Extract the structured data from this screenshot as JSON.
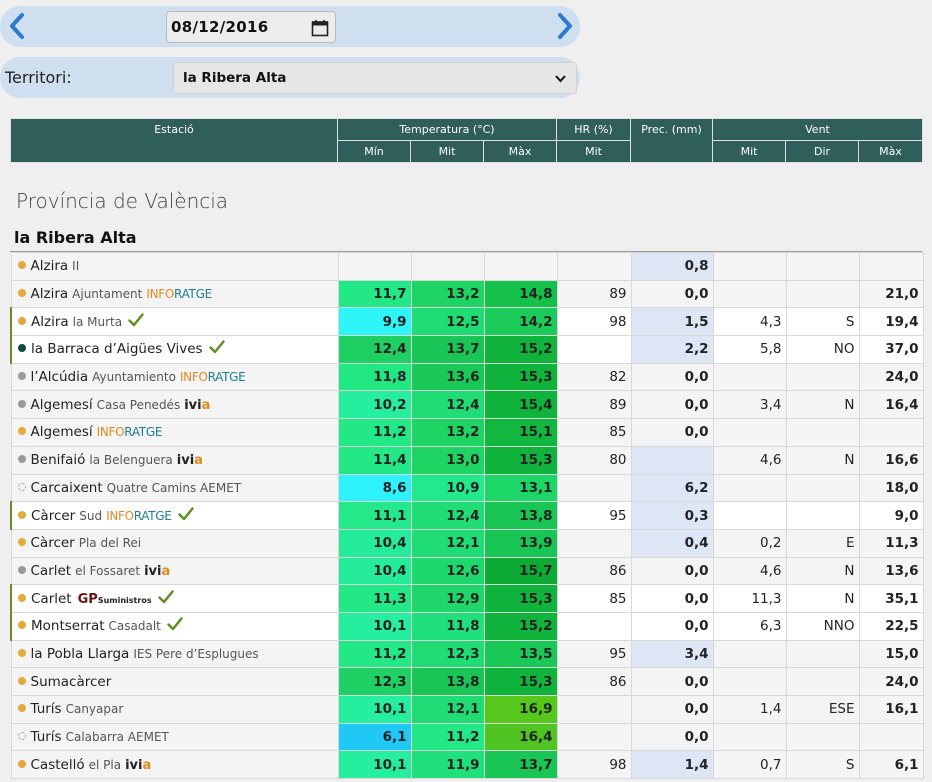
{
  "date_nav": {
    "date": "08/12/2016",
    "prev_icon": "chevron-left-icon",
    "next_icon": "chevron-right-icon",
    "calendar_icon": "calendar-icon"
  },
  "territory": {
    "label": "Territori:",
    "selected": "la Ribera Alta"
  },
  "header": {
    "station": "Estació",
    "temperature": "Temperatura (°C)",
    "humidity": "HR (%)",
    "precipitation": "Prec. (mm)",
    "wind": "Vent",
    "temp_min": "Mín",
    "temp_mit": "Mit",
    "temp_max": "Màx",
    "hr_mit": "Mit",
    "wind_mit": "Mit",
    "wind_dir": "Dir",
    "wind_max": "Màx"
  },
  "province": "Província de València",
  "region": "la Ribera Alta",
  "colors": {
    "header_bg": "#2f5e5b",
    "dot_orange": "#e2a93b",
    "dot_gray": "#9a9a9a",
    "dot_teal": "#0c4a48",
    "check_green": "#5e8e1c"
  },
  "stations": [
    {
      "name": "Alzira",
      "sub": "II",
      "logo": "",
      "dot": "orange",
      "check": false,
      "hl": false,
      "min": "",
      "mit": "",
      "max": "",
      "hr": "",
      "prec": "0,8",
      "prec_bg": true,
      "w_mit": "",
      "w_dir": "",
      "w_max": "",
      "c_min": "",
      "c_mit": "",
      "c_max": ""
    },
    {
      "name": "Alzira",
      "sub": "Ajuntament",
      "logo": "inforatge",
      "dot": "orange",
      "check": false,
      "hl": false,
      "min": "11,7",
      "mit": "13,2",
      "max": "14,8",
      "hr": "89",
      "prec": "0,0",
      "prec_bg": false,
      "w_mit": "",
      "w_dir": "",
      "w_max": "21,0",
      "c_min": "#22e886",
      "c_mit": "#1ed563",
      "c_max": "#15c04b"
    },
    {
      "name": "Alzira",
      "sub": "la Murta",
      "logo": "",
      "dot": "orange",
      "check": true,
      "hl": true,
      "min": "9,9",
      "mit": "12,5",
      "max": "14,2",
      "hr": "98",
      "prec": "1,5",
      "prec_bg": true,
      "w_mit": "4,3",
      "w_dir": "S",
      "w_max": "19,4",
      "c_min": "#2ef5f7",
      "c_mit": "#1fdc75",
      "c_max": "#1bcc5a"
    },
    {
      "name": "la Barraca d’Aigües Vives",
      "sub": "",
      "logo": "",
      "dot": "teal",
      "check": true,
      "hl": true,
      "min": "12,4",
      "mit": "13,7",
      "max": "15,2",
      "hr": "",
      "prec": "2,2",
      "prec_bg": true,
      "w_mit": "5,8",
      "w_dir": "NO",
      "w_max": "37,0",
      "c_min": "#1ecf62",
      "c_mit": "#19c554",
      "c_max": "#10b33c"
    },
    {
      "name": "l’Alcúdia",
      "sub": "Ayuntamiento",
      "logo": "inforatge",
      "dot": "gray",
      "check": false,
      "hl": false,
      "min": "11,8",
      "mit": "13,6",
      "max": "15,3",
      "hr": "82",
      "prec": "0,0",
      "prec_bg": false,
      "w_mit": "",
      "w_dir": "",
      "w_max": "24,0",
      "c_min": "#21e780",
      "c_mit": "#1ac857",
      "c_max": "#10b33c"
    },
    {
      "name": "Algemesí",
      "sub": "Casa Penedés",
      "logo": "ivia",
      "dot": "gray",
      "check": false,
      "hl": false,
      "min": "10,2",
      "mit": "12,4",
      "max": "15,4",
      "hr": "89",
      "prec": "0,0",
      "prec_bg": false,
      "w_mit": "3,4",
      "w_dir": "N",
      "w_max": "16,4",
      "c_min": "#26ee9f",
      "c_mit": "#1fdc75",
      "c_max": "#10b33c"
    },
    {
      "name": "Algemesí",
      "sub": "",
      "logo": "inforatge",
      "dot": "orange",
      "check": false,
      "hl": false,
      "min": "11,2",
      "mit": "13,2",
      "max": "15,1",
      "hr": "85",
      "prec": "0,0",
      "prec_bg": false,
      "w_mit": "",
      "w_dir": "",
      "w_max": "",
      "c_min": "#22e886",
      "c_mit": "#1ed563",
      "c_max": "#12b740"
    },
    {
      "name": "Benifaió",
      "sub": "la Belenguera",
      "logo": "ivia",
      "dot": "gray",
      "check": false,
      "hl": false,
      "min": "11,4",
      "mit": "13,0",
      "max": "15,3",
      "hr": "80",
      "prec": "",
      "prec_bg": true,
      "w_mit": "4,6",
      "w_dir": "N",
      "w_max": "16,6",
      "c_min": "#22e886",
      "c_mit": "#1ed563",
      "c_max": "#10b33c"
    },
    {
      "name": "Carcaixent",
      "sub": "Quatre Camins AEMET",
      "logo": "",
      "dot": "hollow",
      "check": false,
      "hl": false,
      "min": "8,6",
      "mit": "10,9",
      "max": "13,1",
      "hr": "",
      "prec": "6,2",
      "prec_bg": true,
      "w_mit": "",
      "w_dir": "",
      "w_max": "18,0",
      "c_min": "#2ef2f9",
      "c_mit": "#22ea8c",
      "c_max": "#1dd668"
    },
    {
      "name": "Càrcer",
      "sub": "Sud",
      "logo": "inforatge",
      "dot": "orange",
      "check": true,
      "hl": true,
      "min": "11,1",
      "mit": "12,4",
      "max": "13,8",
      "hr": "95",
      "prec": "0,3",
      "prec_bg": true,
      "w_mit": "",
      "w_dir": "",
      "w_max": "9,0",
      "c_min": "#23e98a",
      "c_mit": "#1fdc75",
      "c_max": "#19c554"
    },
    {
      "name": "Càrcer",
      "sub": "Pla del Rei",
      "logo": "",
      "dot": "orange",
      "check": false,
      "hl": false,
      "min": "10,4",
      "mit": "12,1",
      "max": "13,9",
      "hr": "",
      "prec": "0,4",
      "prec_bg": true,
      "w_mit": "0,2",
      "w_dir": "E",
      "w_max": "11,3",
      "c_min": "#25ec98",
      "c_mit": "#1fdc75",
      "c_max": "#19c554"
    },
    {
      "name": "Carlet",
      "sub": "el Fossaret",
      "logo": "ivia",
      "dot": "gray",
      "check": false,
      "hl": false,
      "min": "10,4",
      "mit": "12,6",
      "max": "15,7",
      "hr": "86",
      "prec": "0,0",
      "prec_bg": false,
      "w_mit": "4,6",
      "w_dir": "N",
      "w_max": "13,6",
      "c_min": "#25ec98",
      "c_mit": "#1ed86e",
      "c_max": "#0dab35"
    },
    {
      "name": "Carlet",
      "sub": "",
      "logo": "gp",
      "dot": "orange",
      "check": true,
      "hl": true,
      "min": "11,3",
      "mit": "12,9",
      "max": "15,3",
      "hr": "85",
      "prec": "0,0",
      "prec_bg": false,
      "w_mit": "11,3",
      "w_dir": "N",
      "w_max": "35,1",
      "c_min": "#22e886",
      "c_mit": "#1ed66a",
      "c_max": "#10b33c"
    },
    {
      "name": "Montserrat",
      "sub": "Casadalt",
      "logo": "",
      "dot": "orange",
      "check": true,
      "hl": true,
      "min": "10,1",
      "mit": "11,8",
      "max": "15,2",
      "hr": "",
      "prec": "0,0",
      "prec_bg": false,
      "w_mit": "6,3",
      "w_dir": "NNO",
      "w_max": "22,5",
      "c_min": "#26ee9f",
      "c_mit": "#20e07c",
      "c_max": "#10b33c"
    },
    {
      "name": "la Pobla Llarga",
      "sub": "IES Pere d’Esplugues",
      "logo": "",
      "dot": "orange",
      "check": false,
      "hl": false,
      "min": "11,2",
      "mit": "12,3",
      "max": "13,5",
      "hr": "95",
      "prec": "3,4",
      "prec_bg": true,
      "w_mit": "",
      "w_dir": "",
      "w_max": "15,0",
      "c_min": "#22e886",
      "c_mit": "#1fdc75",
      "c_max": "#1ac857"
    },
    {
      "name": "Sumacàrcer",
      "sub": "",
      "logo": "",
      "dot": "orange",
      "check": false,
      "hl": false,
      "min": "12,3",
      "mit": "13,8",
      "max": "15,3",
      "hr": "86",
      "prec": "0,0",
      "prec_bg": false,
      "w_mit": "",
      "w_dir": "",
      "w_max": "24,0",
      "c_min": "#1fd064",
      "c_mit": "#19c554",
      "c_max": "#10b33c"
    },
    {
      "name": "Turís",
      "sub": "Canyapar",
      "logo": "",
      "dot": "orange",
      "check": false,
      "hl": false,
      "min": "10,1",
      "mit": "12,1",
      "max": "16,9",
      "hr": "",
      "prec": "0,0",
      "prec_bg": false,
      "w_mit": "1,4",
      "w_dir": "ESE",
      "w_max": "16,1",
      "c_min": "#26ee9f",
      "c_mit": "#1fdc75",
      "c_max": "#56c81c"
    },
    {
      "name": "Turís",
      "sub": "Calabarra AEMET",
      "logo": "",
      "dot": "hollow",
      "check": false,
      "hl": false,
      "min": "6,1",
      "mit": "11,2",
      "max": "16,4",
      "hr": "",
      "prec": "0,0",
      "prec_bg": false,
      "w_mit": "",
      "w_dir": "",
      "w_max": "",
      "c_min": "#1fc8f5",
      "c_mit": "#22e886",
      "c_max": "#4fc422"
    },
    {
      "name": "Castelló",
      "sub": "el Pla",
      "logo": "ivia",
      "dot": "orange",
      "check": false,
      "hl": false,
      "min": "10,1",
      "mit": "11,9",
      "max": "13,7",
      "hr": "98",
      "prec": "1,4",
      "prec_bg": true,
      "w_mit": "0,7",
      "w_dir": "S",
      "w_max": "6,1",
      "c_min": "#26ee9f",
      "c_mit": "#20e07c",
      "c_max": "#19c554"
    }
  ]
}
